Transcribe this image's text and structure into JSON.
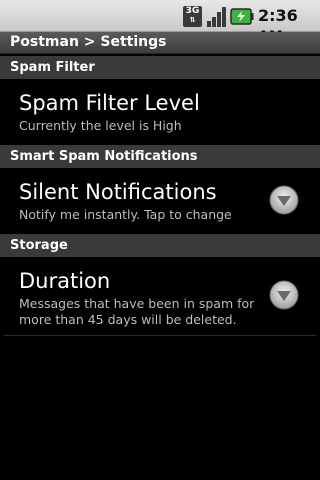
{
  "status_bar": {
    "network_type": "3G",
    "time": "2:36",
    "ampm": "AM",
    "icons": [
      "3g-data-icon",
      "signal-strength-icon",
      "battery-charging-icon"
    ]
  },
  "title_bar": {
    "title": "Postman > Settings"
  },
  "sections": [
    {
      "header": "Spam Filter",
      "items": [
        {
          "title": "Spam Filter Level",
          "summary": "Currently the level is High"
        }
      ]
    },
    {
      "header": "Smart Spam Notifications",
      "items": [
        {
          "title": "Silent Notifications",
          "summary": "Notify me instantly. Tap to change",
          "icon": "dropdown-arrow-icon"
        }
      ]
    },
    {
      "header": "Storage",
      "items": [
        {
          "title": "Duration",
          "summary": "Messages that have been in spam for more than 45 days will be deleted.",
          "icon": "dropdown-arrow-icon"
        }
      ]
    }
  ],
  "colors": {
    "background": "#000000",
    "category_bg": "#3a3a3a",
    "summary_text": "#bdbdbd",
    "battery_green": "#3cb43c"
  }
}
